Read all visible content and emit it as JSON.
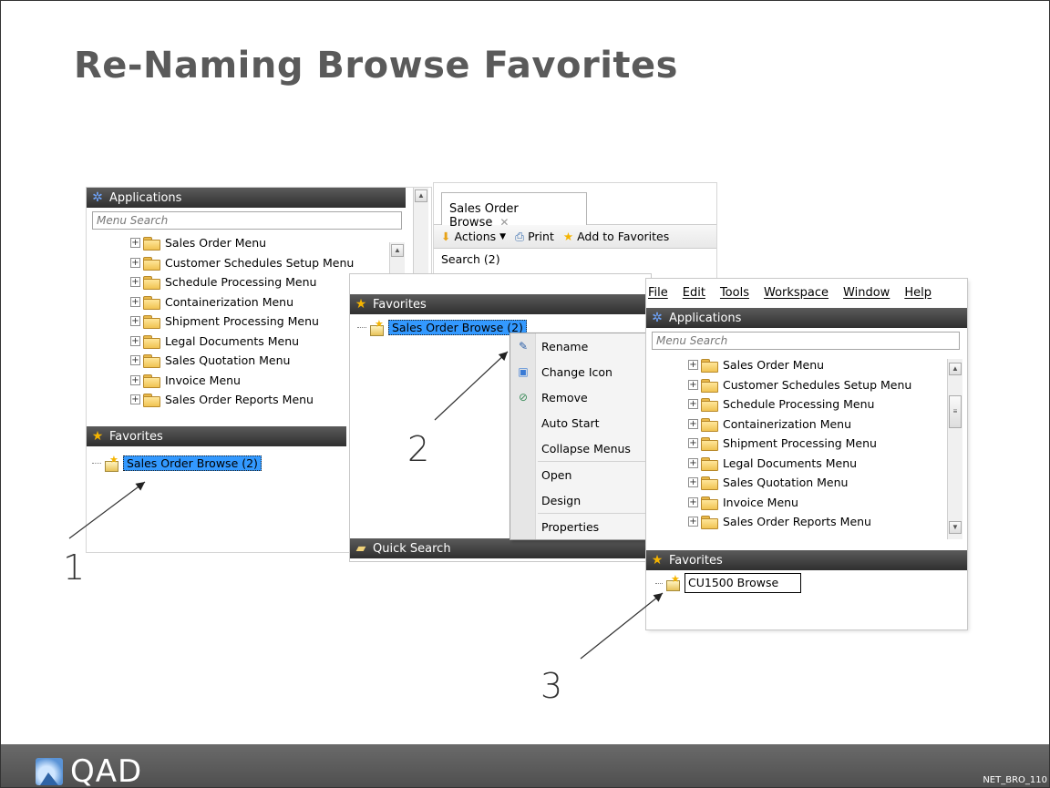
{
  "slide": {
    "title": "Re-Naming Browse Favorites",
    "doc_id": "NET_BRO_110"
  },
  "footer": {
    "logo_text": "QAD"
  },
  "steps": [
    "1",
    "2",
    "3"
  ],
  "menu_items": [
    "Sales Order Menu",
    "Customer Schedules Setup Menu",
    "Schedule Processing Menu",
    "Containerization Menu",
    "Shipment Processing Menu",
    "Legal Documents Menu",
    "Sales Quotation Menu",
    "Invoice Menu",
    "Sales Order Reports Menu"
  ],
  "panel1": {
    "apps_header": "Applications",
    "menu_search_placeholder": "Menu Search",
    "favorites_header": "Favorites",
    "favorite_item": "Sales Order Browse (2)"
  },
  "browse": {
    "tab_label": "Sales Order Browse",
    "tab_close": "✕",
    "actions_label": "Actions",
    "print_label": "Print",
    "add_fav_label": "Add to Favorites",
    "search_label": "Search (2)"
  },
  "panel2": {
    "favorites_header": "Favorites",
    "favorite_item": "Sales Order Browse (2)",
    "quick_search_header": "Quick Search"
  },
  "context_menu": {
    "rename": "Rename",
    "change_icon": "Change Icon",
    "remove": "Remove",
    "auto_start": "Auto Start",
    "collapse_menus": "Collapse Menus",
    "open": "Open",
    "design": "Design",
    "properties": "Properties"
  },
  "panel3": {
    "menubar": [
      "File",
      "Edit",
      "Tools",
      "Workspace",
      "Window",
      "Help"
    ],
    "apps_header": "Applications",
    "menu_search_placeholder": "Menu Search",
    "favorites_header": "Favorites",
    "rename_value": "CU1500 Browse"
  }
}
